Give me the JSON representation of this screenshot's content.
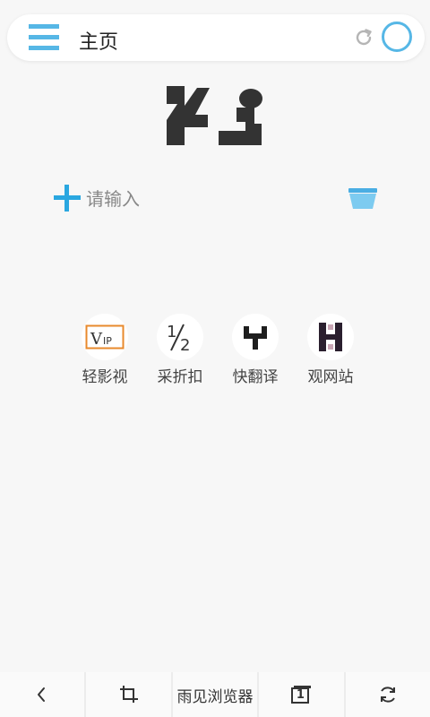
{
  "header": {
    "title": "主页",
    "menu_icon": "hamburger-menu-icon",
    "refresh_icon": "refresh-icon",
    "status_icon": "circle-ring-icon",
    "accent_color": "#56b7e6"
  },
  "logo": {
    "icon": "app-logo"
  },
  "search": {
    "placeholder": "请输入",
    "value": "",
    "add_icon": "plus-icon",
    "clear_icon": "basket-icon",
    "accent_color": "#2aa7e0"
  },
  "shortcuts": [
    {
      "label": "轻影视",
      "icon": "vip-icon"
    },
    {
      "label": "采折扣",
      "icon": "half-icon"
    },
    {
      "label": "快翻译",
      "icon": "y-icon"
    },
    {
      "label": "观网站",
      "icon": "h-icon"
    }
  ],
  "bottom_nav": {
    "back_icon": "chevron-left-icon",
    "crop_icon": "crop-icon",
    "center_label": "雨见浏览器",
    "tab_count_icon": "tab-count-icon",
    "tab_count": "1",
    "sync_icon": "sync-icon"
  }
}
